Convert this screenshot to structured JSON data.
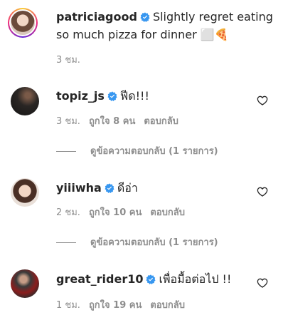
{
  "caption": {
    "username": "patriciagood",
    "text_line1": "Slightly regret eating",
    "text_line2": "so much pizza for dinner",
    "emoji": "⬜🍕",
    "time": "3 ชม."
  },
  "comments": [
    {
      "username": "topiz_js",
      "text": "ฟีด!!!",
      "time": "3 ชม.",
      "likes": "ถูกใจ 8 คน",
      "reply_label": "ตอบกลับ",
      "view_replies": "ดูข้อความตอบกลับ (1 รายการ)"
    },
    {
      "username": "yiiiwha",
      "text": "ดีอ่า",
      "time": "2 ชม.",
      "likes": "ถูกใจ 10 คน",
      "reply_label": "ตอบกลับ",
      "view_replies": "ดูข้อความตอบกลับ (1 รายการ)"
    },
    {
      "username": "great_rider10",
      "text": "เพื่อมื้อต่อไป !!",
      "time": "1 ชม.",
      "likes": "ถูกใจ 19 คน",
      "reply_label": "ตอบกลับ"
    }
  ],
  "icons": {
    "verified": "verified-badge-icon",
    "like": "heart-icon"
  },
  "colors": {
    "verified_blue": "#3897f0",
    "text": "#262626",
    "secondary": "#8e8e8e"
  }
}
